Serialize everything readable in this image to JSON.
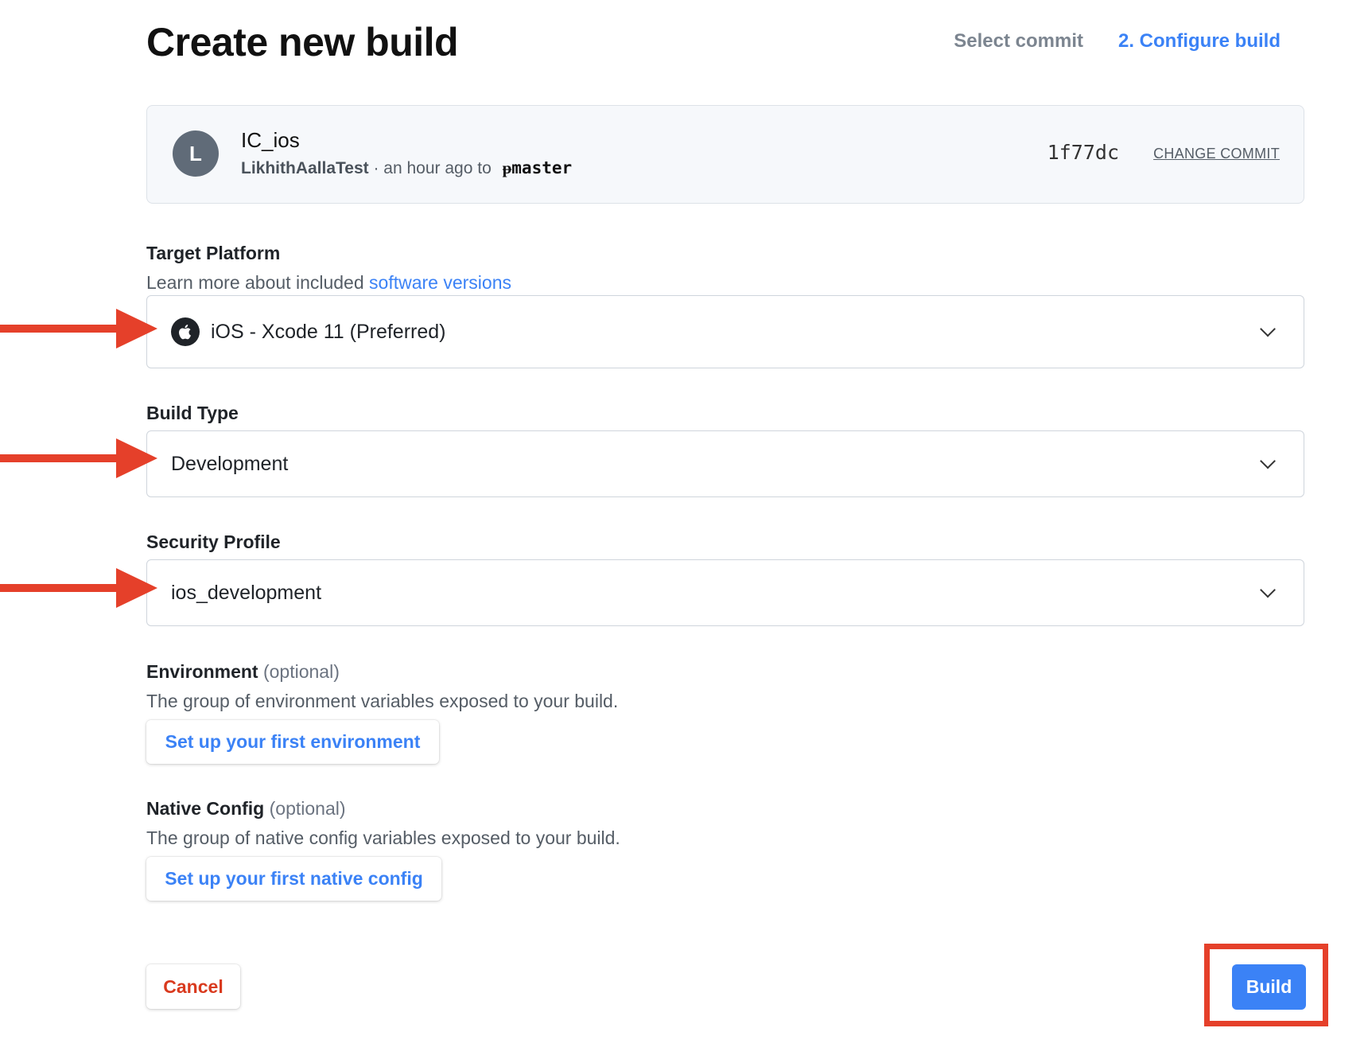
{
  "header": {
    "title": "Create new build",
    "steps": [
      "Select commit",
      "2. Configure build"
    ]
  },
  "commit": {
    "avatar_initial": "L",
    "repo_name": "IC_ios",
    "author": "LikhithAallaTest",
    "time_text": " · an hour ago to ",
    "branch_icon": "branch-icon",
    "branch": "master",
    "sha": "1f77dc",
    "change_label": "CHANGE COMMIT"
  },
  "target_platform": {
    "label": "Target Platform",
    "desc_prefix": "Learn more about included ",
    "desc_link": "software versions",
    "icon": "apple-icon",
    "value": "iOS - Xcode 11 (Preferred)"
  },
  "build_type": {
    "label": "Build Type",
    "value": "Development"
  },
  "security_profile": {
    "label": "Security Profile",
    "value": "ios_development"
  },
  "environment": {
    "label": "Environment",
    "optional": " (optional)",
    "desc": "The group of environment variables exposed to your build.",
    "button": "Set up your first environment"
  },
  "native_config": {
    "label": "Native Config",
    "optional": " (optional)",
    "desc": "The group of native config variables exposed to your build.",
    "button": "Set up your first native config"
  },
  "footer": {
    "cancel": "Cancel",
    "build": "Build"
  },
  "colors": {
    "accent": "#3b82f6",
    "annotation": "#e5402a",
    "cancel": "#d93a1e"
  }
}
